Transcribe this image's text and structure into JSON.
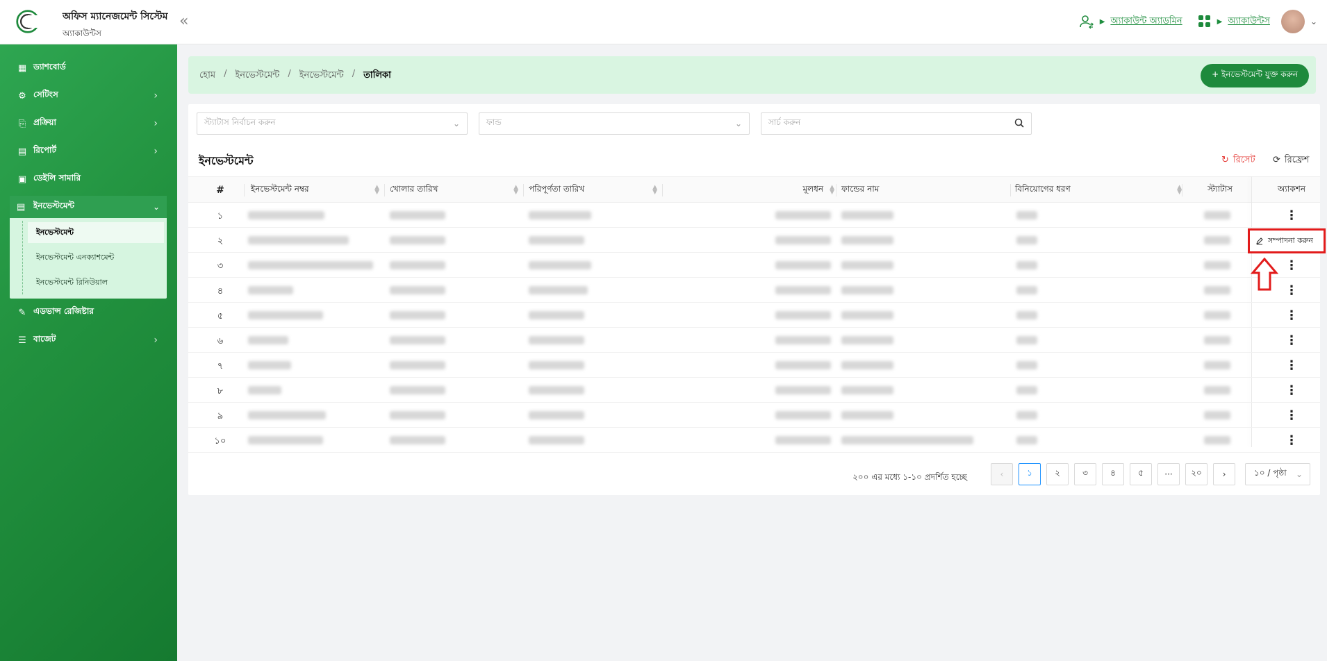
{
  "app": {
    "title": "অফিস ম্যানেজমেন্ট সিস্টেম",
    "subtitle": "অ্যাকাউন্টস",
    "collapse_icon": "double-chevron-left-icon"
  },
  "header_right": {
    "role_link": "অ্যাকাউন্ট অ্যাডমিন",
    "module_link": "অ্যাকাউন্টস"
  },
  "sidebar": {
    "items": [
      {
        "label": "ড্যাশবোর্ড",
        "icon": "dashboard-icon"
      },
      {
        "label": "সেটিংস",
        "icon": "gear-icon"
      },
      {
        "label": "প্রক্রিয়া",
        "icon": "process-icon"
      },
      {
        "label": "রিপোর্ট",
        "icon": "report-icon"
      },
      {
        "label": "ডেইলি সামারি",
        "icon": "summary-icon"
      },
      {
        "label": "ইনভেস্টমেন্ট",
        "icon": "investment-icon"
      },
      {
        "label": "এডভান্স রেজিষ্টার",
        "icon": "register-icon"
      },
      {
        "label": "বাজেট",
        "icon": "budget-icon"
      }
    ],
    "sub_items": [
      {
        "label": "ইনভেস্টমেন্ট"
      },
      {
        "label": "ইনভেস্টমেন্ট এনক্যাশমেন্ট"
      },
      {
        "label": "ইনভেস্টমেন্ট রিনিউয়াল"
      }
    ]
  },
  "breadcrumb": {
    "items": [
      "হোম",
      "ইনভেস্টমেন্ট",
      "ইনভেস্টমেন্ট",
      "তালিকা"
    ],
    "separator": "/"
  },
  "add_button": "+ ইনভেস্টমেন্ট যুক্ত করুন",
  "filters": {
    "status_placeholder": "স্ট্যাটাস নির্বাচন করুন",
    "fund_placeholder": "ফান্ড",
    "search_placeholder": "সার্চ করুন"
  },
  "list": {
    "title": "ইনভেস্টমেন্ট",
    "reset": "রিসেট",
    "refresh": "রিফ্রেশ"
  },
  "table": {
    "columns": [
      "#",
      "ইনভেস্টমেন্ট নম্বর",
      "খোলার তারিখ",
      "পরিপূর্ণতা তারিখ",
      "মূলধন",
      "ফান্ডের নাম",
      "বিনিয়োগের ধরণ",
      "স্ট্যাটাস",
      "অ্যাকশন"
    ],
    "rows": [
      "১",
      "২",
      "৩",
      "৪",
      "৫",
      "৬",
      "৭",
      "৮",
      "৯",
      "১০"
    ]
  },
  "row_menu": {
    "edit_label": "সম্পাদনা করুন"
  },
  "pagination": {
    "info": "২০০ এর মধ্যে ১-১০ প্রদর্শিত হচ্ছে",
    "pages": [
      "১",
      "২",
      "৩",
      "৪",
      "৫",
      "···",
      "২০"
    ],
    "current": "১",
    "page_size": "১০ / পৃষ্ঠা"
  },
  "colors": {
    "brand": "#1e8a3c",
    "highlight": "#e21b1b",
    "active_page": "#1890ff"
  }
}
